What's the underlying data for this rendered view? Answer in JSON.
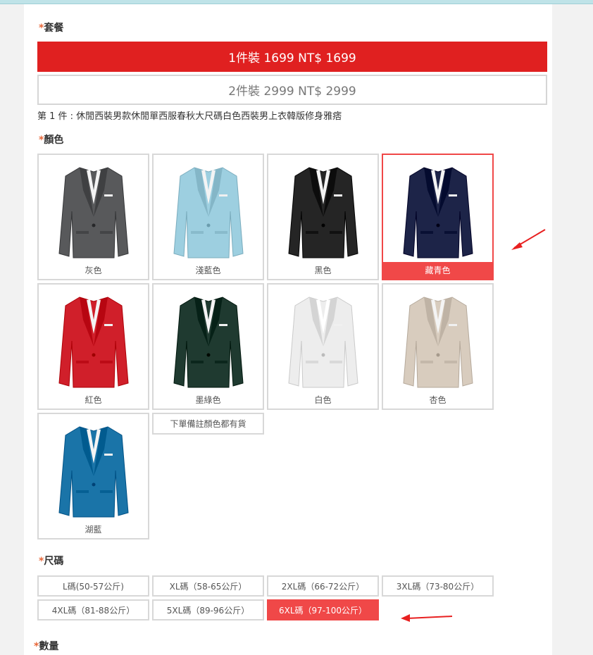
{
  "package": {
    "label": "套餐",
    "options": [
      {
        "text": "1件裝 1699 NT$ 1699",
        "selected": true
      },
      {
        "text": "2件裝 2999 NT$ 2999",
        "selected": false
      }
    ],
    "description": "第 1 件 : 休閒西裝男款休閒單西服春秋大尺碼白色西裝男上衣韓版修身雅痞"
  },
  "color": {
    "label": "顏色",
    "options": [
      {
        "name": "灰色",
        "hex": "#58595b",
        "selected": false
      },
      {
        "name": "淺藍色",
        "hex": "#9dcfe0",
        "selected": false
      },
      {
        "name": "黑色",
        "hex": "#252525",
        "selected": false
      },
      {
        "name": "藏青色",
        "hex": "#1d2448",
        "selected": true
      },
      {
        "name": "紅色",
        "hex": "#d01f2a",
        "selected": false
      },
      {
        "name": "墨綠色",
        "hex": "#1f3a30",
        "selected": false
      },
      {
        "name": "白色",
        "hex": "#ededed",
        "selected": false
      },
      {
        "name": "杏色",
        "hex": "#d8ccbe",
        "selected": false
      },
      {
        "name": "湖藍",
        "hex": "#1a74a8",
        "selected": false
      }
    ],
    "note_option": "下單備註顏色都有貨"
  },
  "size": {
    "label": "尺碼",
    "options": [
      {
        "text": "L碼(50-57公斤)",
        "selected": false
      },
      {
        "text": "XL碼（58-65公斤）",
        "selected": false
      },
      {
        "text": "2XL碼（66-72公斤）",
        "selected": false
      },
      {
        "text": "3XL碼（73-80公斤）",
        "selected": false
      },
      {
        "text": "4XL碼（81-88公斤）",
        "selected": false
      },
      {
        "text": "5XL碼（89-96公斤）",
        "selected": false
      },
      {
        "text": "6XL碼（97-100公斤）",
        "selected": true
      }
    ]
  },
  "quantity": {
    "label": "數量"
  },
  "colors": {
    "accent": "#e02020",
    "selected_swatch": "#f04848",
    "required_star": "#e8683a"
  }
}
